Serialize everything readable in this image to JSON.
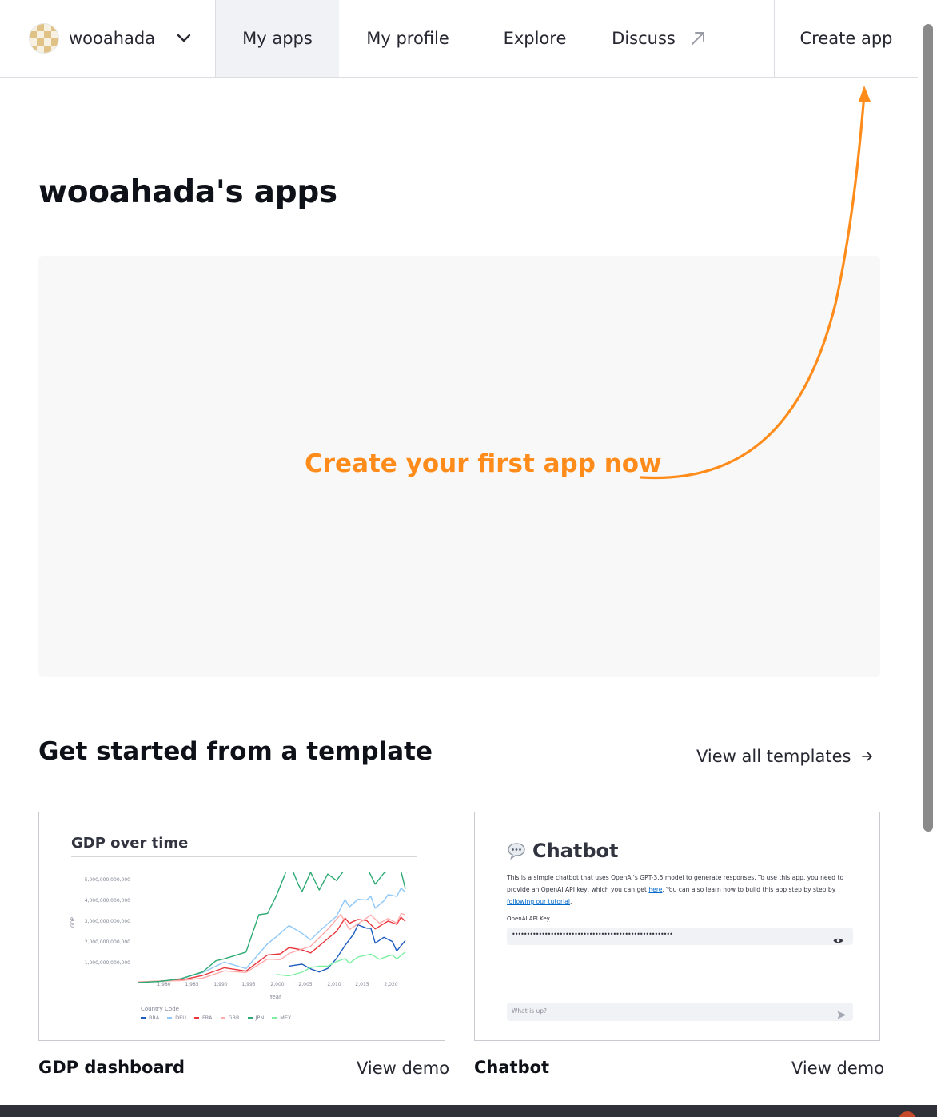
{
  "nav": {
    "username": "wooahada",
    "items": [
      {
        "label": "My apps"
      },
      {
        "label": "My profile"
      },
      {
        "label": "Explore"
      },
      {
        "label": "Discuss"
      }
    ],
    "create_app": "Create app"
  },
  "main": {
    "title": "wooahada's apps",
    "cta": "Create your first app now",
    "accent_color": "#ff8c1a"
  },
  "templates": {
    "heading": "Get started from a template",
    "view_all": "View all templates",
    "cards": [
      {
        "name": "GDP dashboard",
        "link": "View demo",
        "preview": {
          "title": "GDP over time",
          "ylabel": "GDP",
          "xlabel": "Year",
          "legend_title": "Country Code"
        }
      },
      {
        "name": "Chatbot",
        "link": "View demo",
        "preview": {
          "title": "Chatbot",
          "desc_1": "This is a simple chatbot that uses OpenAI's GPT-3.5 model to generate responses. To use this app, you need to provide an OpenAI API key, which you can get ",
          "desc_link_1": "here",
          "desc_2": ". You can also learn how to build this app step by step by ",
          "desc_link_2": "following our tutorial",
          "desc_3": ".",
          "key_label": "OpenAI API Key",
          "key_value": "••••••••••••••••••••••••••••••••••••••••••••••••••••••",
          "chat_placeholder": "What is up?"
        }
      }
    ]
  },
  "chart_data": {
    "type": "line",
    "title": "GDP over time",
    "xlabel": "Year",
    "ylabel": "GDP",
    "legend_title": "Country Code",
    "x_ticks": [
      "1,980",
      "1,985",
      "1,990",
      "1,995",
      "2,000",
      "2,005",
      "2,010",
      "2,015",
      "2,020"
    ],
    "y_ticks": [
      "1,000,000,000,000",
      "2,000,000,000,000",
      "3,000,000,000,000",
      "4,000,000,000,000",
      "5,000,000,000,000"
    ],
    "xlim": [
      1960,
      2022
    ],
    "ylim": [
      0,
      5500000000000
    ],
    "series": [
      {
        "name": "BRA",
        "color": "#1c5bbf",
        "points": [
          [
            1995,
            0.77
          ],
          [
            1998,
            0.86
          ],
          [
            2000,
            0.65
          ],
          [
            2002,
            0.51
          ],
          [
            2004,
            0.67
          ],
          [
            2006,
            1.11
          ],
          [
            2008,
            1.7
          ],
          [
            2010,
            2.21
          ],
          [
            2011,
            2.62
          ],
          [
            2013,
            2.47
          ],
          [
            2014,
            2.46
          ],
          [
            2015,
            1.8
          ],
          [
            2017,
            2.06
          ],
          [
            2019,
            1.87
          ],
          [
            2020,
            1.45
          ],
          [
            2022,
            1.92
          ]
        ]
      },
      {
        "name": "DEU",
        "color": "#8fc8f6",
        "points": [
          [
            1970,
            0.22
          ],
          [
            1975,
            0.49
          ],
          [
            1980,
            0.95
          ],
          [
            1985,
            0.66
          ],
          [
            1990,
            1.77
          ],
          [
            1992,
            2.08
          ],
          [
            1995,
            2.59
          ],
          [
            1998,
            2.24
          ],
          [
            2000,
            1.95
          ],
          [
            2003,
            2.5
          ],
          [
            2006,
            3.0
          ],
          [
            2008,
            3.75
          ],
          [
            2009,
            3.42
          ],
          [
            2011,
            3.76
          ],
          [
            2013,
            3.73
          ],
          [
            2014,
            3.89
          ],
          [
            2015,
            3.36
          ],
          [
            2017,
            3.69
          ],
          [
            2018,
            3.97
          ],
          [
            2020,
            3.89
          ],
          [
            2021,
            4.26
          ],
          [
            2022,
            4.08
          ]
        ]
      },
      {
        "name": "FRA",
        "color": "#e8363c",
        "points": [
          [
            1960,
            0.06
          ],
          [
            1970,
            0.15
          ],
          [
            1975,
            0.36
          ],
          [
            1980,
            0.7
          ],
          [
            1985,
            0.55
          ],
          [
            1990,
            1.27
          ],
          [
            1993,
            1.32
          ],
          [
            1995,
            1.6
          ],
          [
            1998,
            1.5
          ],
          [
            2000,
            1.36
          ],
          [
            2003,
            1.84
          ],
          [
            2006,
            2.32
          ],
          [
            2008,
            2.92
          ],
          [
            2009,
            2.69
          ],
          [
            2011,
            2.86
          ],
          [
            2013,
            2.81
          ],
          [
            2015,
            2.44
          ],
          [
            2018,
            2.79
          ],
          [
            2020,
            2.64
          ],
          [
            2021,
            2.96
          ],
          [
            2022,
            2.78
          ]
        ]
      },
      {
        "name": "GBR",
        "color": "#ffabab",
        "points": [
          [
            1960,
            0.07
          ],
          [
            1970,
            0.13
          ],
          [
            1975,
            0.24
          ],
          [
            1980,
            0.56
          ],
          [
            1985,
            0.49
          ],
          [
            1990,
            1.09
          ],
          [
            1993,
            1.06
          ],
          [
            1995,
            1.34
          ],
          [
            2000,
            1.66
          ],
          [
            2004,
            2.42
          ],
          [
            2007,
            3.09
          ],
          [
            2009,
            2.41
          ],
          [
            2011,
            2.66
          ],
          [
            2014,
            3.06
          ],
          [
            2016,
            2.69
          ],
          [
            2018,
            2.9
          ],
          [
            2020,
            2.7
          ],
          [
            2021,
            3.12
          ],
          [
            2022,
            3.07
          ]
        ]
      },
      {
        "name": "JPN",
        "color": "#2eaa73",
        "points": [
          [
            1960,
            0.04
          ],
          [
            1965,
            0.09
          ],
          [
            1970,
            0.21
          ],
          [
            1975,
            0.52
          ],
          [
            1978,
            1.01
          ],
          [
            1980,
            1.1
          ],
          [
            1985,
            1.4
          ],
          [
            1988,
            3.07
          ],
          [
            1990,
            3.13
          ],
          [
            1992,
            3.9
          ],
          [
            1994,
            4.85
          ],
          [
            1995,
            5.45
          ],
          [
            1997,
            4.49
          ],
          [
            1998,
            4.1
          ],
          [
            2000,
            4.97
          ],
          [
            2002,
            4.18
          ],
          [
            2004,
            4.89
          ],
          [
            2006,
            4.6
          ],
          [
            2008,
            5.11
          ],
          [
            2010,
            5.76
          ],
          [
            2012,
            6.27
          ],
          [
            2013,
            5.21
          ],
          [
            2015,
            4.44
          ],
          [
            2017,
            4.93
          ],
          [
            2018,
            5.04
          ],
          [
            2020,
            5.05
          ],
          [
            2021,
            5.01
          ],
          [
            2022,
            4.23
          ]
        ]
      },
      {
        "name": "MEX",
        "color": "#7defa1",
        "points": [
          [
            1992,
            0.4
          ],
          [
            1995,
            0.34
          ],
          [
            1998,
            0.5
          ],
          [
            2000,
            0.71
          ],
          [
            2002,
            0.77
          ],
          [
            2004,
            0.77
          ],
          [
            2006,
            0.97
          ],
          [
            2008,
            1.11
          ],
          [
            2009,
            0.9
          ],
          [
            2011,
            1.18
          ],
          [
            2014,
            1.31
          ],
          [
            2016,
            1.08
          ],
          [
            2018,
            1.22
          ],
          [
            2019,
            1.27
          ],
          [
            2020,
            1.09
          ],
          [
            2022,
            1.41
          ]
        ]
      }
    ]
  }
}
